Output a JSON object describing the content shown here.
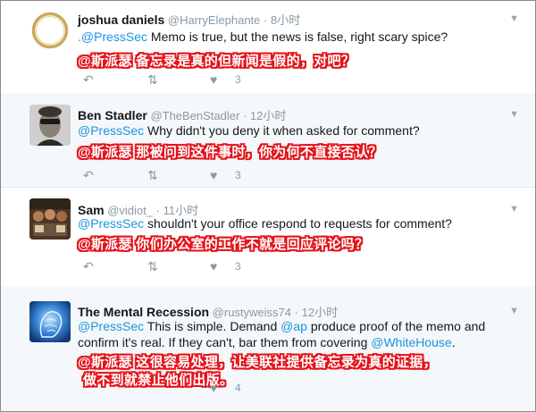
{
  "tweets": [
    {
      "name": "joshua daniels",
      "handle": "@HarryElephante",
      "dot": "·",
      "time": "8小时",
      "reply_to": ".@PressSec",
      "text": " Memo is true, but the news is false, right scary spice?",
      "translation": "@斯派瑟 备忘录是真的但新闻是假的，对吧？",
      "likes": "3"
    },
    {
      "name": "Ben Stadler",
      "handle": "@TheBenStadler",
      "dot": "·",
      "time": "12小时",
      "reply_to": "@PressSec",
      "text": " Why didn't you deny it when asked for comment?",
      "translation": "@斯派瑟 那被问到这件事时，你为何不直接否认？",
      "likes": "3"
    },
    {
      "name": "Sam",
      "handle": "@vidiot_",
      "dot": "·",
      "time": "11小时",
      "reply_to": "@PressSec",
      "text": " shouldn't your office respond to requests for comment?",
      "translation": "@斯派瑟 你们办公室的工作不就是回应评论吗？",
      "likes": "3"
    },
    {
      "name": "The Mental Recession",
      "handle": "@rustyweiss74",
      "dot": "·",
      "time": "12小时",
      "reply_to": "@PressSec",
      "text_a": " This is simple. Demand ",
      "mention_ap": "@ap",
      "text_b": " produce proof of the memo and",
      "text_line2": "confirm it's real. If they can't, bar them from covering ",
      "mention_wh": "@WhiteHouse",
      "text_end": ".",
      "translation_line1": "@斯派瑟 这很容易处理，让美联社提供备忘录为真的证据，",
      "translation_line2": "做不到就禁止他们出版。",
      "likes": "4"
    }
  ],
  "icons": {
    "reply": "reply-icon",
    "retweet": "retweet-icon",
    "like": "heart-icon",
    "more": "chevron-down-icon"
  },
  "colors": {
    "link": "#1b95e0",
    "meta": "#8899a6",
    "overlay_red": "#e4141b"
  }
}
